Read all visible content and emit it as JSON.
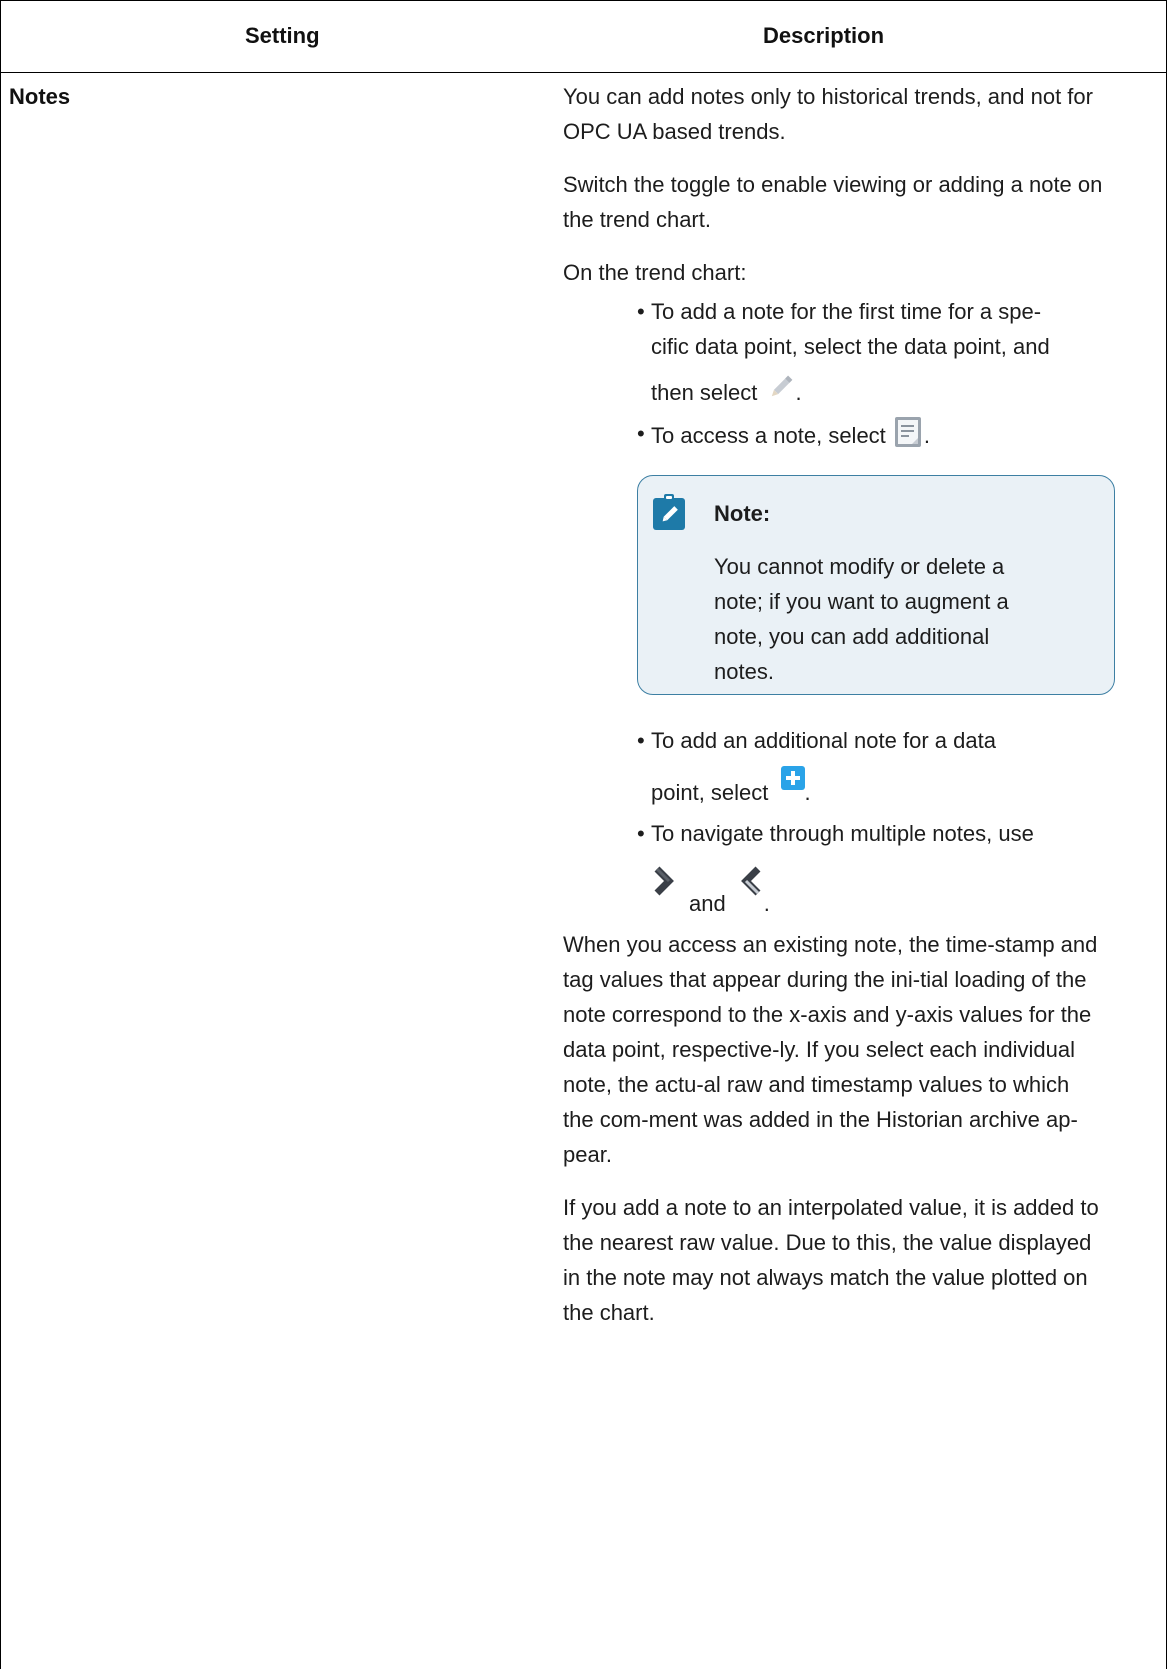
{
  "table": {
    "headers": {
      "setting": "Setting",
      "description": "Description"
    }
  },
  "row": {
    "setting": "Notes",
    "p1": "You can add notes only to historical trends, and not for OPC UA based trends.",
    "p2": "Switch the toggle to enable viewing or adding a note on the trend chart.",
    "p3": "On the trend chart:",
    "bullet1_line1": "To add a note for the first time for a spe-",
    "bullet1_line2": "cific data point, select the data point, and",
    "bullet1_line3": "then select",
    "bullet2": "To access a note, select",
    "note": {
      "title": "Note:",
      "text": "You cannot modify or delete a note; if you want to augment a note, you can add additional notes."
    },
    "bullet3_line1": "To add an additional note for a data",
    "bullet3_line2": "point, select",
    "bullet4_line1": "To navigate through multiple notes, use",
    "and_word": "and",
    "p4": "When you access an existing note, the time-stamp and tag values that appear during the ini-tial loading of the note correspond to the x-axis and y-axis values for the data point, respective-ly. If you select each individual note, the actu-al raw and timestamp values to which the com-ment was added in the Historian archive ap-pear.",
    "p5": "If you add a note to an interpolated value, it is added to the nearest raw value. Due to this, the value displayed in the note may not always match the value plotted on the chart."
  },
  "icons": {
    "edit": "pencil-icon",
    "view_note": "note-document-icon",
    "add": "plus-icon",
    "next": "chevron-right-icon",
    "previous": "chevron-left-icon",
    "note_badge": "pencil-badge-icon"
  },
  "colors": {
    "note_background": "#eaf1f6",
    "note_border": "#3d7fa3",
    "badge": "#1e7aa8",
    "plus": "#2aa3e8"
  }
}
